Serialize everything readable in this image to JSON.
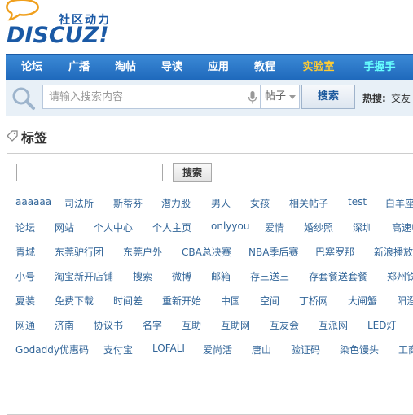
{
  "logo": {
    "sub": "社区动力",
    "main": "DISCUZ!"
  },
  "nav": {
    "items": [
      "论坛",
      "广播",
      "淘帖",
      "导读",
      "应用",
      "教程",
      "实验室",
      "手握手"
    ]
  },
  "search": {
    "placeholder": "请输入搜索内容",
    "type_value": "帖子",
    "button": "搜索",
    "hot_label": "热搜:",
    "hot_words": [
      "交友"
    ]
  },
  "page": {
    "title": "标签"
  },
  "tag_search": {
    "button": "搜索"
  },
  "tags": [
    [
      "aaaaaa",
      "司法所",
      "斯蒂芬",
      "潜力股",
      "男人",
      "女孩",
      "相关帖子",
      "test",
      "白羊座"
    ],
    [
      "论坛",
      "网站",
      "个人中心",
      "个人主页",
      "onlyyou",
      "爱情",
      "婚纱照",
      "深圳",
      "高速申"
    ],
    [
      "青城",
      "东莞驴行团",
      "东莞户外",
      "CBA总决赛",
      "NBA季后赛",
      "巴塞罗那",
      "新浪播放"
    ],
    [
      "小号",
      "淘宝新开店铺",
      "搜索",
      "微博",
      "邮箱",
      "存三送三",
      "存套餐送套餐",
      "郑州铁"
    ],
    [
      "夏装",
      "免费下载",
      "时间差",
      "重新开始",
      "中国",
      "空间",
      "丁桥网",
      "大闸蟹",
      "阳澄"
    ],
    [
      "网通",
      "济南",
      "协议书",
      "名字",
      "互助",
      "互助网",
      "互友会",
      "互派网",
      "LED灯"
    ],
    [
      "Godaddy优惠码",
      "支付宝",
      "LOFALI",
      "爱尚活",
      "唐山",
      "验证码",
      "染色馒头",
      "工商"
    ]
  ]
}
